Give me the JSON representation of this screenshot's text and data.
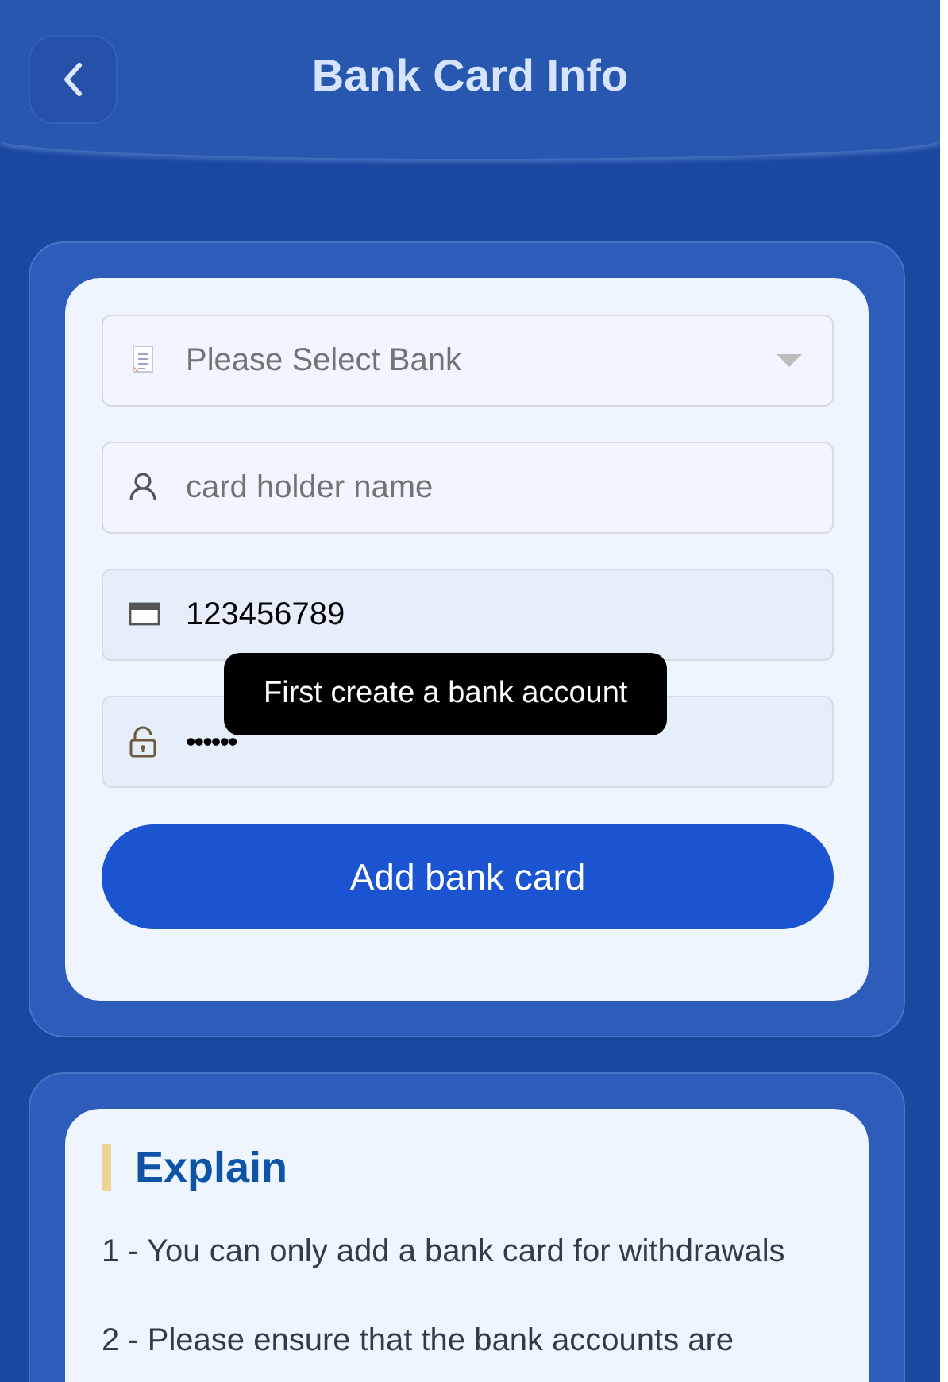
{
  "header": {
    "title": "Bank Card Info"
  },
  "form": {
    "fields": [
      {
        "kind": "select",
        "placeholder": "Please Select Bank"
      },
      {
        "kind": "text",
        "placeholder": "card holder name"
      },
      {
        "kind": "text",
        "value": "123456789"
      },
      {
        "kind": "password",
        "value": "••••••"
      }
    ],
    "button": "Add bank card",
    "tooltip": "First create a bank account"
  },
  "explain": {
    "title": "Explain",
    "items": [
      "1 - You can only add a bank card for withdrawals",
      "2 - Please ensure that the bank accounts are"
    ]
  }
}
